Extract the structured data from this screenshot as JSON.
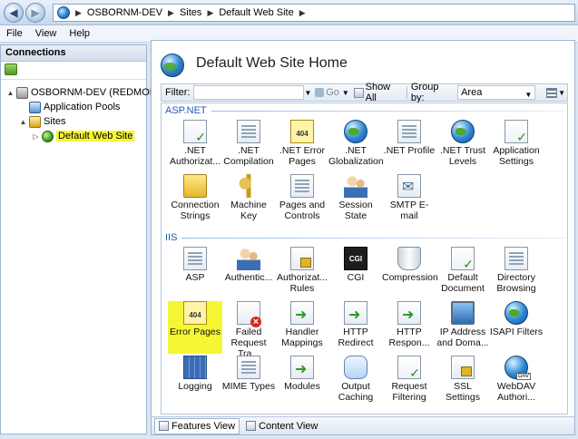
{
  "address_bar": {
    "crumbs": [
      "OSBORNM-DEV",
      "Sites",
      "Default Web Site"
    ]
  },
  "menu": [
    "File",
    "View",
    "Help"
  ],
  "connections": {
    "title": "Connections",
    "tree": [
      {
        "label": "OSBORNM-DEV (REDMOND\\",
        "level": 0,
        "expander": "▲",
        "icon": "server-icon"
      },
      {
        "label": "Application Pools",
        "level": 1,
        "expander": "",
        "icon": "app-pools-icon"
      },
      {
        "label": "Sites",
        "level": 1,
        "expander": "▲",
        "icon": "sites-icon"
      },
      {
        "label": "Default Web Site",
        "level": 2,
        "expander": "▷",
        "icon": "website-globe-icon",
        "selected": true
      }
    ]
  },
  "main": {
    "title": "Default Web Site Home",
    "filter": {
      "label": "Filter:",
      "value": "",
      "go_label": "Go",
      "show_all_label": "Show All",
      "group_by_label": "Group by:",
      "group_by_value": "Area"
    },
    "groups": [
      {
        "name": "ASP.NET",
        "items": [
          {
            "label": ".NET Authorizat...",
            "icon": "net-authorization-icon",
            "style": "i-check"
          },
          {
            "label": ".NET Compilation",
            "icon": "net-compilation-icon",
            "style": "i-doc"
          },
          {
            "label": ".NET Error Pages",
            "icon": "net-error-pages-icon",
            "style": "i-err"
          },
          {
            "label": ".NET Globalization",
            "icon": "net-globalization-icon",
            "style": "i-globe"
          },
          {
            "label": ".NET Profile",
            "icon": "net-profile-icon",
            "style": "i-doc"
          },
          {
            "label": ".NET Trust Levels",
            "icon": "net-trust-levels-icon",
            "style": "i-globe"
          },
          {
            "label": "Application Settings",
            "icon": "application-settings-icon",
            "style": "i-check"
          },
          {
            "label": "Connection Strings",
            "icon": "connection-strings-icon",
            "style": "i-folder"
          },
          {
            "label": "Machine Key",
            "icon": "machine-key-icon",
            "style": "i-key"
          },
          {
            "label": "Pages and Controls",
            "icon": "pages-controls-icon",
            "style": "i-doc"
          },
          {
            "label": "Session State",
            "icon": "session-state-icon",
            "style": "i-people"
          },
          {
            "label": "SMTP E-mail",
            "icon": "smtp-email-icon",
            "style": "i-mail"
          }
        ]
      },
      {
        "name": "IIS",
        "items": [
          {
            "label": "ASP",
            "icon": "asp-icon",
            "style": "i-doc"
          },
          {
            "label": "Authentic...",
            "icon": "authentication-icon",
            "style": "i-people"
          },
          {
            "label": "Authorizat... Rules",
            "icon": "authorization-rules-icon",
            "style": "i-lock"
          },
          {
            "label": "CGI",
            "icon": "cgi-icon",
            "style": "i-cgi"
          },
          {
            "label": "Compression",
            "icon": "compression-icon",
            "style": "i-compress"
          },
          {
            "label": "Default Document",
            "icon": "default-document-icon",
            "style": "i-check"
          },
          {
            "label": "Directory Browsing",
            "icon": "directory-browsing-icon",
            "style": "i-doc"
          },
          {
            "label": "Error Pages",
            "icon": "error-pages-icon",
            "style": "i-err",
            "highlight": true
          },
          {
            "label": "Failed Request Tra...",
            "icon": "failed-request-tracing-icon",
            "style": "i-red"
          },
          {
            "label": "Handler Mappings",
            "icon": "handler-mappings-icon",
            "style": "i-arrow"
          },
          {
            "label": "HTTP Redirect",
            "icon": "http-redirect-icon",
            "style": "i-arrow"
          },
          {
            "label": "HTTP Respon...",
            "icon": "http-response-headers-icon",
            "style": "i-arrow"
          },
          {
            "label": "IP Address and Doma...",
            "icon": "ip-address-domain-icon",
            "style": "i-monitor"
          },
          {
            "label": "ISAPI Filters",
            "icon": "isapi-filters-icon",
            "style": "i-globe"
          },
          {
            "label": "Logging",
            "icon": "logging-icon",
            "style": "i-books"
          },
          {
            "label": "MIME Types",
            "icon": "mime-types-icon",
            "style": "i-doc"
          },
          {
            "label": "Modules",
            "icon": "modules-icon",
            "style": "i-arrow"
          },
          {
            "label": "Output Caching",
            "icon": "output-caching-icon",
            "style": "i-cloud"
          },
          {
            "label": "Request Filtering",
            "icon": "request-filtering-icon",
            "style": "i-check"
          },
          {
            "label": "SSL Settings",
            "icon": "ssl-settings-icon",
            "style": "i-lock"
          },
          {
            "label": "WebDAV Authori...",
            "icon": "webdav-authoring-icon",
            "style": "i-dav"
          }
        ]
      }
    ]
  },
  "view_tabs": [
    {
      "label": "Features View",
      "active": true,
      "icon": "features-view-icon"
    },
    {
      "label": "Content View",
      "active": false,
      "icon": "content-view-icon"
    }
  ]
}
